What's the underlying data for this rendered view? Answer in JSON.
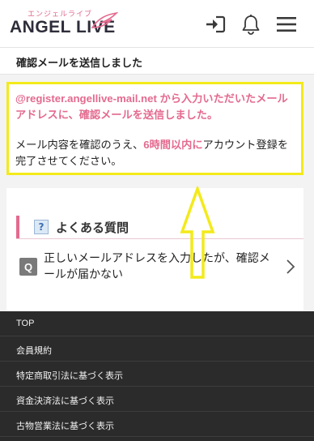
{
  "header": {
    "logo_kana": "エンジェルライブ",
    "logo_text": "ANGEL LIVE",
    "icons": [
      "login-icon",
      "bell-icon",
      "menu-icon"
    ],
    "colors": {
      "brand_pink": "#e46a8f",
      "logo_dark": "#2d2d3a"
    }
  },
  "page": {
    "title": "確認メールを送信しました"
  },
  "message": {
    "line1": "@register.angellive-mail.net から入力いただいたメールアドレスに、確認メールを送信しました。",
    "line2_before": "メール内容を確認のうえ、",
    "line2_emphasis": "6時間以内に",
    "line2_after": "アカウント登録を完了させてください。",
    "highlight_color": "#f3ea1a"
  },
  "faq": {
    "icon": "?",
    "title": "よくある質問",
    "items": [
      {
        "badge": "Q",
        "text": "正しいメールアドレスを入力したが、確認メールが届かない"
      }
    ]
  },
  "footer": {
    "links": [
      "TOP",
      "会員規約",
      "特定商取引法に基づく表示",
      "資金決済法に基づく表示",
      "古物営業法に基づく表示"
    ]
  }
}
